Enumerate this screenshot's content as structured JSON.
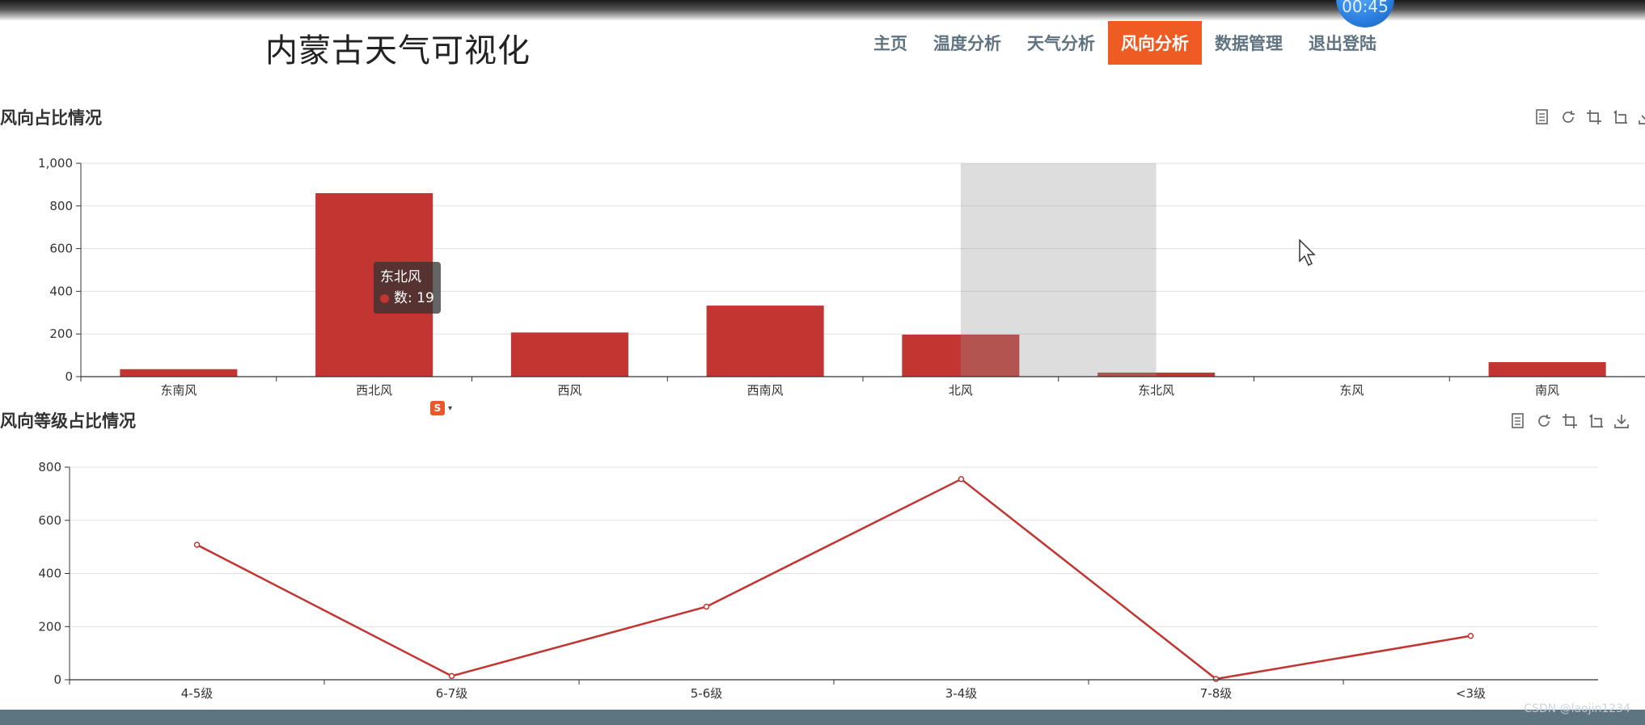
{
  "header": {
    "site_title": "内蒙古天气可视化",
    "timer": "00:45",
    "nav": [
      {
        "label": "主页",
        "active": false
      },
      {
        "label": "温度分析",
        "active": false
      },
      {
        "label": "天气分析",
        "active": false
      },
      {
        "label": "风向分析",
        "active": true
      },
      {
        "label": "数据管理",
        "active": false
      },
      {
        "label": "退出登陆",
        "active": false
      }
    ],
    "accent_color": "#ef5c23"
  },
  "toolbox_icons": [
    "data-view-icon",
    "restore-icon",
    "zoom-icon",
    "zoom-reset-icon",
    "save-image-icon"
  ],
  "tooltip": {
    "title": "东北风",
    "label": "数: 19"
  },
  "watermark": "CSDN @laojin1234",
  "chart_data": [
    {
      "type": "bar",
      "title": "风向占比情况",
      "categories": [
        "东南风",
        "西北风",
        "西风",
        "西南风",
        "北风",
        "东北风",
        "东风",
        "南风"
      ],
      "values": [
        35,
        860,
        207,
        333,
        197,
        19,
        2,
        68
      ],
      "ylim": [
        0,
        1000
      ],
      "yticks": [
        "0",
        "200",
        "400",
        "600",
        "800",
        "1,000"
      ],
      "highlight_category": "东北风",
      "grid": true,
      "color": "#c23531"
    },
    {
      "type": "line",
      "title": "风向等级占比情况",
      "categories": [
        "4-5级",
        "6-7级",
        "5-6级",
        "3-4级",
        "7-8级",
        "<3级"
      ],
      "values": [
        508,
        14,
        275,
        755,
        3,
        165
      ],
      "ylim": [
        0,
        800
      ],
      "yticks": [
        "0",
        "200",
        "400",
        "600",
        "800"
      ],
      "grid": true,
      "color": "#c23531"
    }
  ]
}
